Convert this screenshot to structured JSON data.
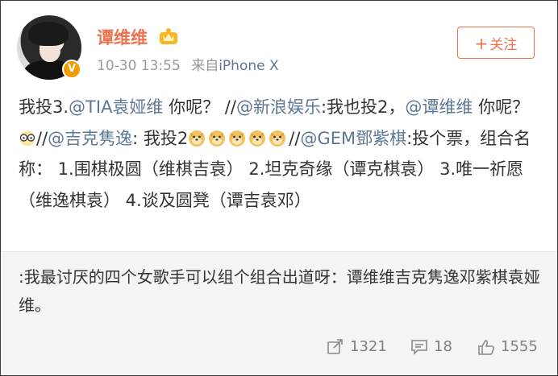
{
  "user": {
    "name": "谭维维",
    "badge_icon": "vip-crown-icon",
    "verified_icon": "verified-v-icon",
    "verified_label": "V"
  },
  "meta": {
    "timestamp": "10-30 13:55",
    "device_prefix": "来自",
    "device": "iPhone X"
  },
  "follow": {
    "plus": "+",
    "label": "关注"
  },
  "post": {
    "t1": "我投3.",
    "m1": "@TIA袁娅维",
    "t2": " 你呢？ //",
    "m2": "@新浪娱乐",
    "t3": ":我也投2，",
    "m3": "@谭维维",
    "t4": " 你呢？ ",
    "emoji_glasses": "glasses-emoji-icon",
    "t5": "//",
    "m4": "@吉克隽逸",
    "t6": ": 我投2",
    "emoji_doge": "doge-emoji-icon",
    "t7": "//",
    "m5": "@GEM鄧紫棋",
    "t8": ":投个票，组合名称： 1.围棋极圆（维棋吉袁） 2.坦克奇缘（谭克棋袁） 3.唯一祈愿 （维逸棋袁） 4.谈及圆凳（谭吉袁邓）"
  },
  "repost": {
    "text": ":我最讨厌的四个女歌手可以组个组合出道呀：谭维维吉克隽逸邓紫棋袁娅维。"
  },
  "actions": {
    "repost_count": "1321",
    "comment_count": "18",
    "like_count": "1555"
  },
  "colors": {
    "accent": "#eb7350",
    "link": "#5d7895",
    "muted": "#999999"
  }
}
